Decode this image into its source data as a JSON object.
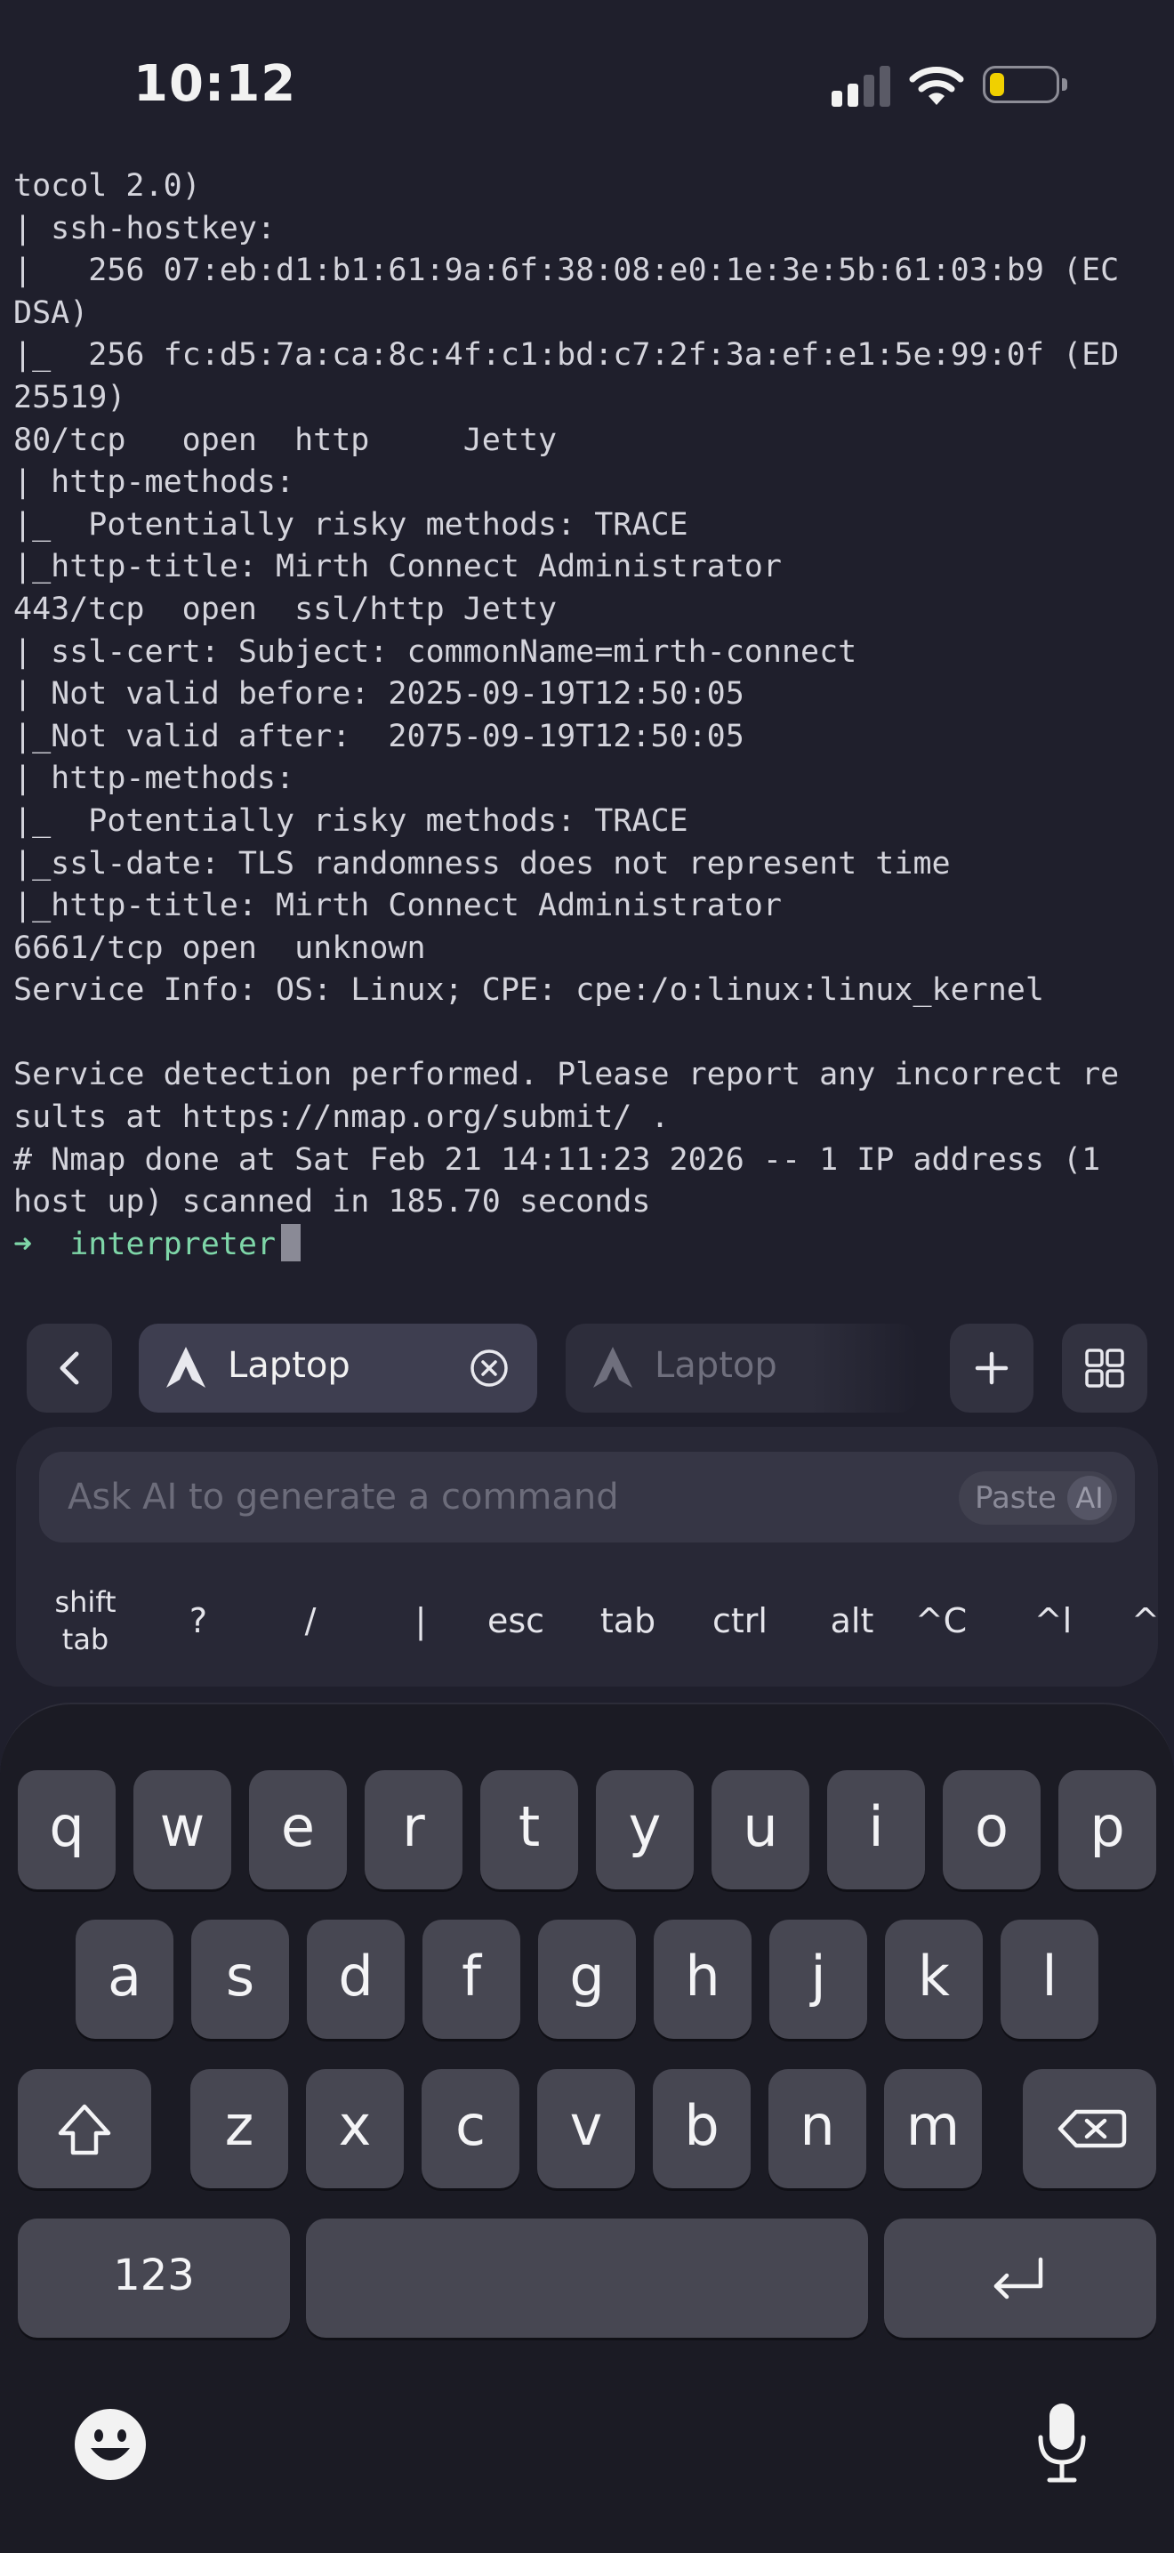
{
  "status_bar": {
    "time": "10:12"
  },
  "terminal": {
    "lines": [
      "tocol 2.0)",
      "| ssh-hostkey:",
      "|   256 07:eb:d1:b1:61:9a:6f:38:08:e0:1e:3e:5b:61:03:b9 (EC",
      "DSA)",
      "|_  256 fc:d5:7a:ca:8c:4f:c1:bd:c7:2f:3a:ef:e1:5e:99:0f (ED",
      "25519)",
      "80/tcp   open  http     Jetty",
      "| http-methods:",
      "|_  Potentially risky methods: TRACE",
      "|_http-title: Mirth Connect Administrator",
      "443/tcp  open  ssl/http Jetty",
      "| ssl-cert: Subject: commonName=mirth-connect",
      "| Not valid before: 2025-09-19T12:50:05",
      "|_Not valid after:  2075-09-19T12:50:05",
      "| http-methods:",
      "|_  Potentially risky methods: TRACE",
      "|_ssl-date: TLS randomness does not represent time",
      "|_http-title: Mirth Connect Administrator",
      "6661/tcp open  unknown",
      "Service Info: OS: Linux; CPE: cpe:/o:linux:linux_kernel",
      "",
      "Service detection performed. Please report any incorrect re",
      "sults at https://nmap.org/submit/ .",
      "# Nmap done at Sat Feb 21 14:11:23 2026 -- 1 IP address (1",
      "host up) scanned in 185.70 seconds"
    ],
    "prompt_arrow": "➜",
    "prompt_dir": "interpreter"
  },
  "sessions": {
    "active_tab": "Laptop",
    "inactive_tab": "Laptop",
    "icons": {
      "back": "chevron-left-icon",
      "close": "close-circle-icon",
      "add": "plus-icon",
      "grid": "grid-icon",
      "tab": "arch-logo-icon"
    }
  },
  "ai_bar": {
    "placeholder": "Ask AI to generate a command",
    "paste_label": "Paste",
    "ai_badge": "AI"
  },
  "extra_keys": {
    "shift_tab_1": "shift",
    "shift_tab_2": "tab",
    "question": "?",
    "slash": "/",
    "pipe": "|",
    "esc": "esc",
    "tab": "tab",
    "ctrl": "ctrl",
    "alt": "alt",
    "ctrl_c": "^C",
    "ctrl_l": "^l",
    "ctrl_s": "^S"
  },
  "keyboard": {
    "row1": [
      "q",
      "w",
      "e",
      "r",
      "t",
      "y",
      "u",
      "i",
      "o",
      "p"
    ],
    "row2": [
      "a",
      "s",
      "d",
      "f",
      "g",
      "h",
      "j",
      "k",
      "l"
    ],
    "row3": [
      "z",
      "x",
      "c",
      "v",
      "b",
      "n",
      "m"
    ],
    "numbers_label": "123",
    "icons": {
      "shift": "shift-icon",
      "backspace": "backspace-icon",
      "return": "return-icon",
      "emoji": "emoji-icon",
      "mic": "microphone-icon"
    }
  }
}
